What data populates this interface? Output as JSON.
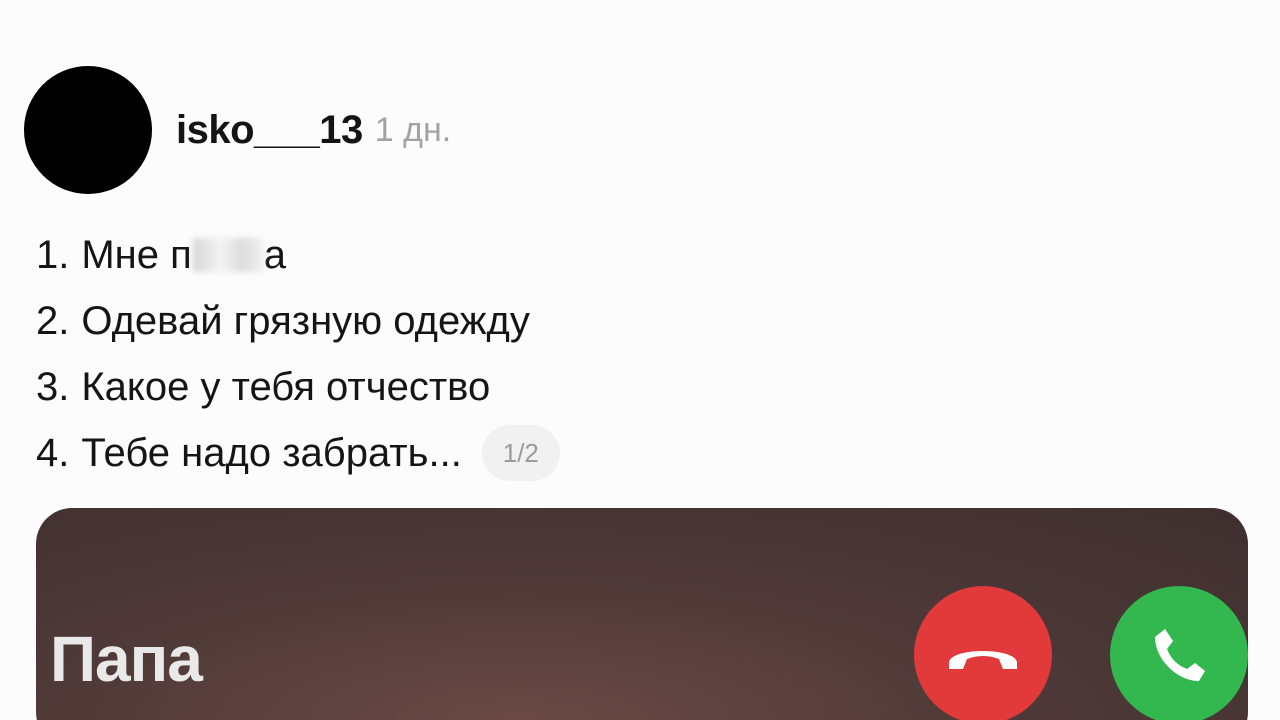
{
  "post": {
    "username": "isko___13",
    "time": "1 дн.",
    "lines": [
      {
        "num": "1.",
        "before": "Мне п",
        "after": "а",
        "redacted": true
      },
      {
        "num": "2.",
        "text": "Одевай грязную одежду"
      },
      {
        "num": "3.",
        "text": "Какое у тебя отчество"
      },
      {
        "num": "4.",
        "text": "Тебе надо забрать..."
      }
    ],
    "page_indicator": "1/2"
  },
  "media": {
    "caller_name": "Папа",
    "decline_icon": "phone-hangup-icon",
    "accept_icon": "phone-icon",
    "colors": {
      "decline": "#e23a3a",
      "accept": "#33b84f"
    }
  }
}
